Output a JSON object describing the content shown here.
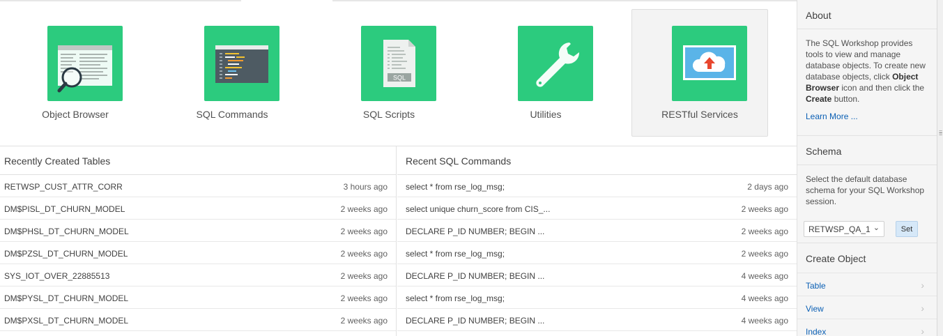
{
  "tiles": [
    {
      "label": "Object Browser",
      "icon": "object-browser-icon"
    },
    {
      "label": "SQL Commands",
      "icon": "sql-commands-icon"
    },
    {
      "label": "SQL Scripts",
      "icon": "sql-scripts-icon"
    },
    {
      "label": "Utilities",
      "icon": "wrench-icon"
    },
    {
      "label": "RESTful Services",
      "icon": "cloud-upload-icon"
    }
  ],
  "sql_scripts_badge": "SQL",
  "recent_tables": {
    "title": "Recently Created Tables",
    "rows": [
      {
        "name": "RETWSP_CUST_ATTR_CORR",
        "time": "3 hours ago"
      },
      {
        "name": "DM$PISL_DT_CHURN_MODEL",
        "time": "2 weeks ago"
      },
      {
        "name": "DM$PHSL_DT_CHURN_MODEL",
        "time": "2 weeks ago"
      },
      {
        "name": "DM$PZSL_DT_CHURN_MODEL",
        "time": "2 weeks ago"
      },
      {
        "name": "SYS_IOT_OVER_22885513",
        "time": "2 weeks ago"
      },
      {
        "name": "DM$PYSL_DT_CHURN_MODEL",
        "time": "2 weeks ago"
      },
      {
        "name": "DM$PXSL_DT_CHURN_MODEL",
        "time": "2 weeks ago"
      }
    ]
  },
  "recent_sql": {
    "title": "Recent SQL Commands",
    "rows": [
      {
        "name": "select * from rse_log_msg;",
        "time": "2 days ago"
      },
      {
        "name": "select unique churn_score from CIS_...",
        "time": "2 weeks ago"
      },
      {
        "name": "DECLARE P_ID NUMBER; BEGIN ...",
        "time": "2 weeks ago"
      },
      {
        "name": "select * from rse_log_msg;",
        "time": "2 weeks ago"
      },
      {
        "name": "DECLARE P_ID NUMBER; BEGIN ...",
        "time": "4 weeks ago"
      },
      {
        "name": "select * from rse_log_msg;",
        "time": "4 weeks ago"
      },
      {
        "name": "DECLARE P_ID NUMBER; BEGIN ...",
        "time": "4 weeks ago"
      }
    ]
  },
  "sidebar": {
    "about_title": "About",
    "about_text_1": "The SQL Workshop provides tools to view and manage database objects. To create new database objects, click ",
    "about_bold_1": "Object Browser",
    "about_text_2": " icon and then click the ",
    "about_bold_2": "Create",
    "about_text_3": " button.",
    "learn_more": "Learn More ...",
    "schema_title": "Schema",
    "schema_text": "Select the default database schema for your SQL Workshop session.",
    "schema_value": "RETWSP_QA_1",
    "set_label": "Set",
    "create_title": "Create Object",
    "create_items": [
      "Table",
      "View",
      "Index"
    ]
  },
  "colors": {
    "tile_green": "#2ccb7e",
    "link_blue": "#0a5fb4"
  }
}
